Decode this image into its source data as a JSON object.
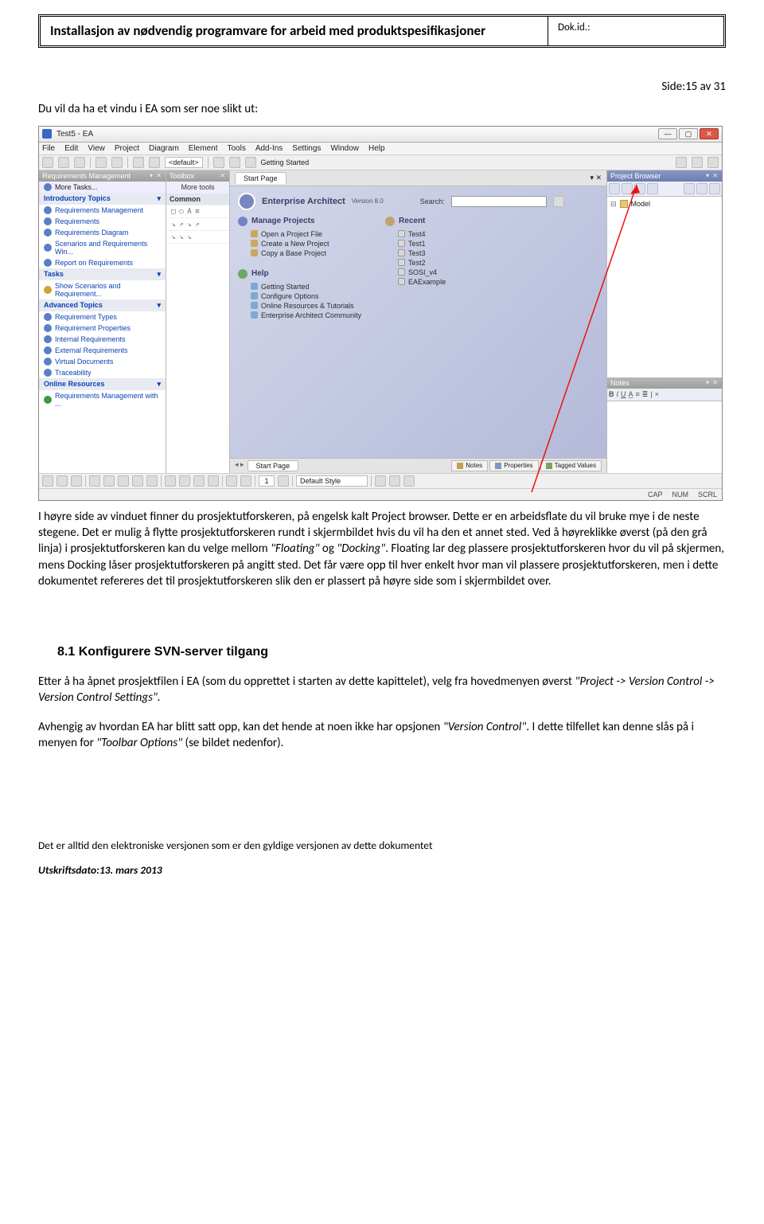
{
  "doc": {
    "header_title": "Installasjon av nødvendig programvare for arbeid med produktspesifikasjoner",
    "dokid_label": "Dok.id.:",
    "page_info": "Side:15 av 31",
    "intro": "Du vil da ha et vindu i EA som ser noe slikt ut:"
  },
  "screenshot": {
    "title": "Test5 - EA",
    "menus": [
      "File",
      "Edit",
      "View",
      "Project",
      "Diagram",
      "Element",
      "Tools",
      "Add-Ins",
      "Settings",
      "Window",
      "Help"
    ],
    "toolbar_default": "<default>",
    "toolbar_getting_started": "Getting Started",
    "left_panel_title": "Requirements Management",
    "more_tasks": "More Tasks...",
    "intro_section": "Introductory Topics",
    "intro_items": [
      "Requirements Management",
      "Requirements",
      "Requirements Diagram",
      "Scenarios and Requirements Win...",
      "Report on Requirements"
    ],
    "tasks_section": "Tasks",
    "tasks_items": [
      "Show Scenarios and Requirement..."
    ],
    "adv_section": "Advanced Topics",
    "adv_items": [
      "Requirement Types",
      "Requirement Properties",
      "Internal Requirements",
      "External Requirements",
      "Virtual Documents",
      "Traceability"
    ],
    "online_section": "Online Resources",
    "online_items": [
      "Requirements Management with ..."
    ],
    "toolbox_title": "Toolbox",
    "toolbox_more": "More tools",
    "toolbox_common": "Common",
    "center_tab": "Start Page",
    "ea_title": "Enterprise Architect",
    "ea_version": "Version  8.0",
    "search_label": "Search:",
    "manage_title": "Manage Projects",
    "manage_items": [
      "Open a Project File",
      "Create a New Project",
      "Copy a Base Project"
    ],
    "recent_title": "Recent",
    "recent_items": [
      "Test4",
      "Test1",
      "Test3",
      "Test2",
      "SOSI_v4",
      "EAExample"
    ],
    "help_title": "Help",
    "help_items": [
      "Getting Started",
      "Configure Options",
      "Online Resources & Tutorials",
      "Enterprise Architect Community"
    ],
    "pb_title": "Project Browser",
    "pb_root": "Model",
    "notes_title": "Notes",
    "bottom_tab": "Start Page",
    "right_tabs": [
      "Notes",
      "Properties",
      "Tagged Values"
    ],
    "toolbar2_default_style": "Default Style",
    "toolbar2_num": "1",
    "status_right": [
      "CAP",
      "NUM",
      "SCRL"
    ]
  },
  "body": {
    "p1_a": "I høyre side av vinduet finner du prosjektutforskeren, på engelsk kalt Project browser. Dette er en arbeidsflate du vil bruke mye i de neste stegene. Det er mulig å flytte prosjektutforskeren rundt i skjermbildet hvis du vil ha den et annet sted. Ved å høyreklikke øverst (på den grå linja) i prosjektutforskeren kan du velge mellom ",
    "p1_i1": "\"Floating\"",
    "p1_mid": " og ",
    "p1_i2": "\"Docking\"",
    "p1_b": ". Floating lar deg plassere prosjektutforskeren hvor du vil på skjermen, mens Docking låser prosjektutforskeren på angitt sted. Det får være opp til hver enkelt hvor man vil plassere prosjektutforskeren, men i dette dokumentet refereres det til prosjektutforskeren slik den er plassert på høyre side som i skjermbildet over.",
    "heading": "8.1 Konfigurere SVN-server tilgang",
    "p2_a": "Etter å ha åpnet prosjektfilen i EA (som du opprettet i starten av dette kapittelet), velg fra hovedmenyen øverst ",
    "p2_i": "\"Project -> Version Control -> Version Control Settings\".",
    "p3_a": "Avhengig av hvordan EA har blitt satt opp, kan det hende at noen ikke har opsjonen ",
    "p3_i1": "\"Version Control\"",
    "p3_mid": ". I dette tilfellet kan denne slås på i menyen for ",
    "p3_i2": "\"Toolbar Options\"",
    "p3_b": " (se bildet nedenfor).",
    "footer": "Det er alltid den elektroniske versjonen som er den gyldige versjonen av dette dokumentet",
    "footer_date": "Utskriftsdato:13. mars 2013"
  }
}
